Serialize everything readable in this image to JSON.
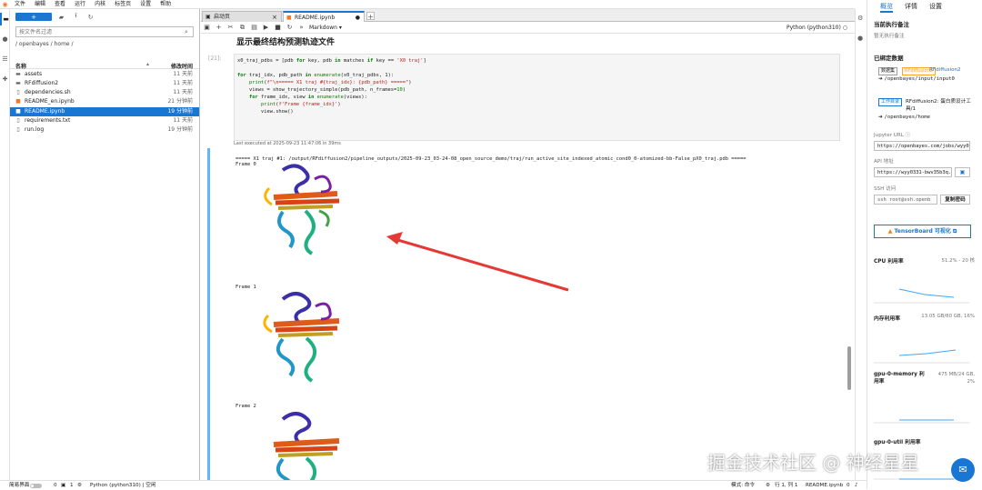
{
  "menubar": {
    "items": [
      "文件",
      "编辑",
      "查看",
      "运行",
      "内核",
      "标签页",
      "设置",
      "帮助"
    ]
  },
  "filebrowser": {
    "new_label": "+",
    "search_placeholder": "按文件名过滤",
    "breadcrumb": "/ openbayes / home /",
    "col_name": "名称",
    "col_modified": "修改时间",
    "files": [
      {
        "name": "assets",
        "time": "11 天前",
        "icon": "folder-icon"
      },
      {
        "name": "RFdiffusion2",
        "time": "11 天前",
        "icon": "folder-icon"
      },
      {
        "name": "dependencies.sh",
        "time": "11 天前",
        "icon": "file-icon"
      },
      {
        "name": "README_en.ipynb",
        "time": "21 分钟前",
        "icon": "notebook-icon"
      },
      {
        "name": "README.ipynb",
        "time": "19 分钟前",
        "icon": "notebook-icon"
      },
      {
        "name": "requirements.txt",
        "time": "11 天前",
        "icon": "file-icon"
      },
      {
        "name": "run.log",
        "time": "19 分钟前",
        "icon": "file-icon"
      }
    ]
  },
  "tabs": [
    {
      "label": "启动页"
    },
    {
      "label": "README.ipynb"
    }
  ],
  "notebook": {
    "cell_type": "Markdown",
    "kernel": "Python (python310)",
    "md_heading": "显示最终结构预测轨迹文件",
    "prompt": "[21]:",
    "last_executed": "Last executed at 2025-09-23 11:47:06 in 39ms",
    "output_header": "===== X1 traj #1: /output/RFdiffusion2/pipeline_outputs/2025-09-23_03-24-08_open_source_demo/traj/run_active_site_indexed_atomic_cond0_0-atomized-bb-False_pX0_traj.pdb =====",
    "frame_labels": [
      "Frame 0",
      "Frame 1",
      "Frame 2"
    ]
  },
  "rpanel": {
    "tabs": [
      "概览",
      "详情",
      "设置"
    ],
    "exec_title": "当前执行备注",
    "exec_sub": "暂无执行备注",
    "bound_title": "已绑定数据",
    "dataset_badge": "数据集",
    "dataset_tag": "RFdiffusion2",
    "dataset_name": "RFdiffusion2",
    "dataset_path": "/openbayes/input/input0",
    "workspace_badge": "工作目录",
    "workspace_name": "RFdiffusion2: 蛋白质设计工具/1",
    "workspace_path": "/openbayes/home",
    "jupyter_label": "Jupyter URL",
    "jupyter_url": "https://openbayes.com/jobs/wyy033",
    "api_label": "API 地址",
    "api_url": "https://wyy0331-bwv35b3q.",
    "ssh_label": "SSH 访问",
    "ssh_cmd": "ssh root@ssh.openb",
    "copy_pwd": "复制密码",
    "tensorboard": "TensorBoard 可视化",
    "metrics": [
      {
        "name": "CPU 利用率",
        "value": "51.2% - 20 核"
      },
      {
        "name": "内存利用率",
        "value": "13.05 GB/80 GB, 16%"
      },
      {
        "name": "gpu-0-memory 利用率",
        "value": "475 MB/24 GB, 2%"
      },
      {
        "name": "gpu-0-util 利用率",
        "value": ""
      }
    ]
  },
  "statusbar": {
    "simple": "简易界面",
    "count1": "0",
    "count2": "1",
    "kernel": "Python (python310) | 空闲",
    "mode": "模式: 命令",
    "position": "行 1, 列 1",
    "file": "README.ipynb",
    "bell": "0"
  },
  "watermark": "掘金技术社区 @ 神经星星"
}
